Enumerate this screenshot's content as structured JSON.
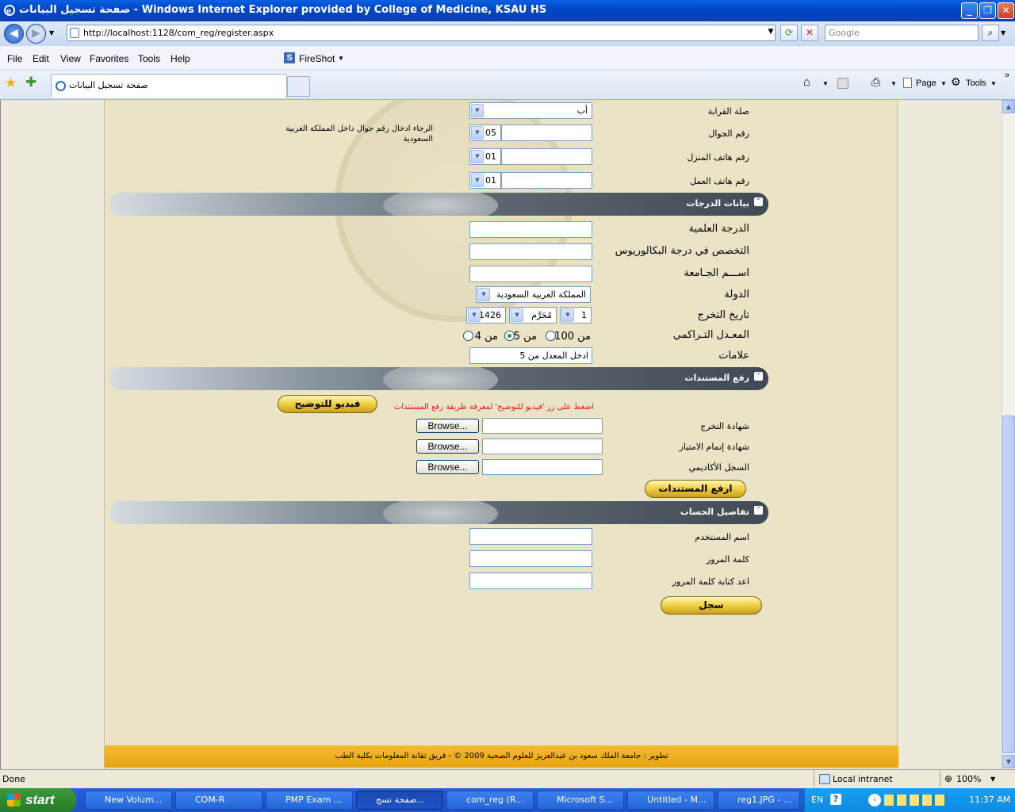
{
  "window": {
    "title": "صفحة تسجيل البيانات - Windows Internet Explorer provided by College of Medicine, KSAU HS",
    "min": "_",
    "max": "❐",
    "close": "✕"
  },
  "address": {
    "url": "http://localhost:1128/com_reg/register.aspx",
    "search_placeholder": "Google"
  },
  "menu": {
    "file": "File",
    "edit": "Edit",
    "view": "View",
    "favorites": "Favorites",
    "tools": "Tools",
    "help": "Help",
    "fireshot": "FireShot"
  },
  "tab": {
    "title": "صفحة تسجيل البيانات",
    "page": "Page",
    "tools": "Tools"
  },
  "form": {
    "relation": {
      "label": "صلة القرابة",
      "value": "أب"
    },
    "mobile": {
      "label": "رقم الجوال",
      "prefix": "05",
      "value": "",
      "hint": "الرجاء ادخال رقم جوال داخل المملكة العربية السعودية"
    },
    "home_phone": {
      "label": "رقم هاتف المنزل",
      "prefix": "01",
      "value": ""
    },
    "work_phone": {
      "label": "رقم هاتف العمل",
      "prefix": "01",
      "value": ""
    },
    "grades_section": "بيانات الدرجات",
    "degree": {
      "label": "الدرجة العلمية",
      "value": ""
    },
    "major": {
      "label": "التخصص في درجة البكالوريوس",
      "value": ""
    },
    "university": {
      "label": "اســـم الجـامعة",
      "value": ""
    },
    "country": {
      "label": "الدولة",
      "value": "المملكة العربية السعودية"
    },
    "grad_date": {
      "label": "تاريخ التخرج",
      "day": "1",
      "month": "مُحَرَّم",
      "year": "1426"
    },
    "gpa": {
      "label": "المعـدل التـراكمي",
      "opt100": "من 100",
      "opt5": "من 5",
      "opt4": "من 4",
      "selected": "5"
    },
    "marks": {
      "label": "علامات",
      "value": "ادخل المعدل من 5"
    },
    "docs_section": "رفع المستندات",
    "video_button": "فيديو للتوضيح",
    "video_hint": "اضغط على زر 'فيديو للتوضيح' لمعرفة طريقة رفع المستندات",
    "cert_grad": "شهادة التخرج",
    "cert_intern": "شهادة إتمام الامتياز",
    "transcript": "السجل الأكاديمي",
    "browse": "Browse...",
    "upload_button": "ارفع المستندات",
    "account_section": "تفاصيل الحساب",
    "username": {
      "label": "اسم المستخدم",
      "value": ""
    },
    "password": {
      "label": "كلمة المرور",
      "value": ""
    },
    "password2": {
      "label": "اعد كتابة كلمة المرور",
      "value": ""
    },
    "submit": "سجل"
  },
  "footer": "تطوير : جامعة الملك سعود بن عبدالعزيز للعلوم الصحية 2009 © - فريق تقانة المعلومات بكلية الطب",
  "status": {
    "text": "Done",
    "zone": "Local intranet",
    "zoom": "100%"
  },
  "taskbar": {
    "start": "start",
    "tasks": [
      "New Volum...",
      "COM-R",
      "PMP Exam ...",
      "صفحة تسج...",
      "com_reg (R...",
      "Microsoft S...",
      "Untitled - M...",
      "reg1.JPG - ..."
    ],
    "lang": "EN",
    "clock": "11:37 AM"
  }
}
